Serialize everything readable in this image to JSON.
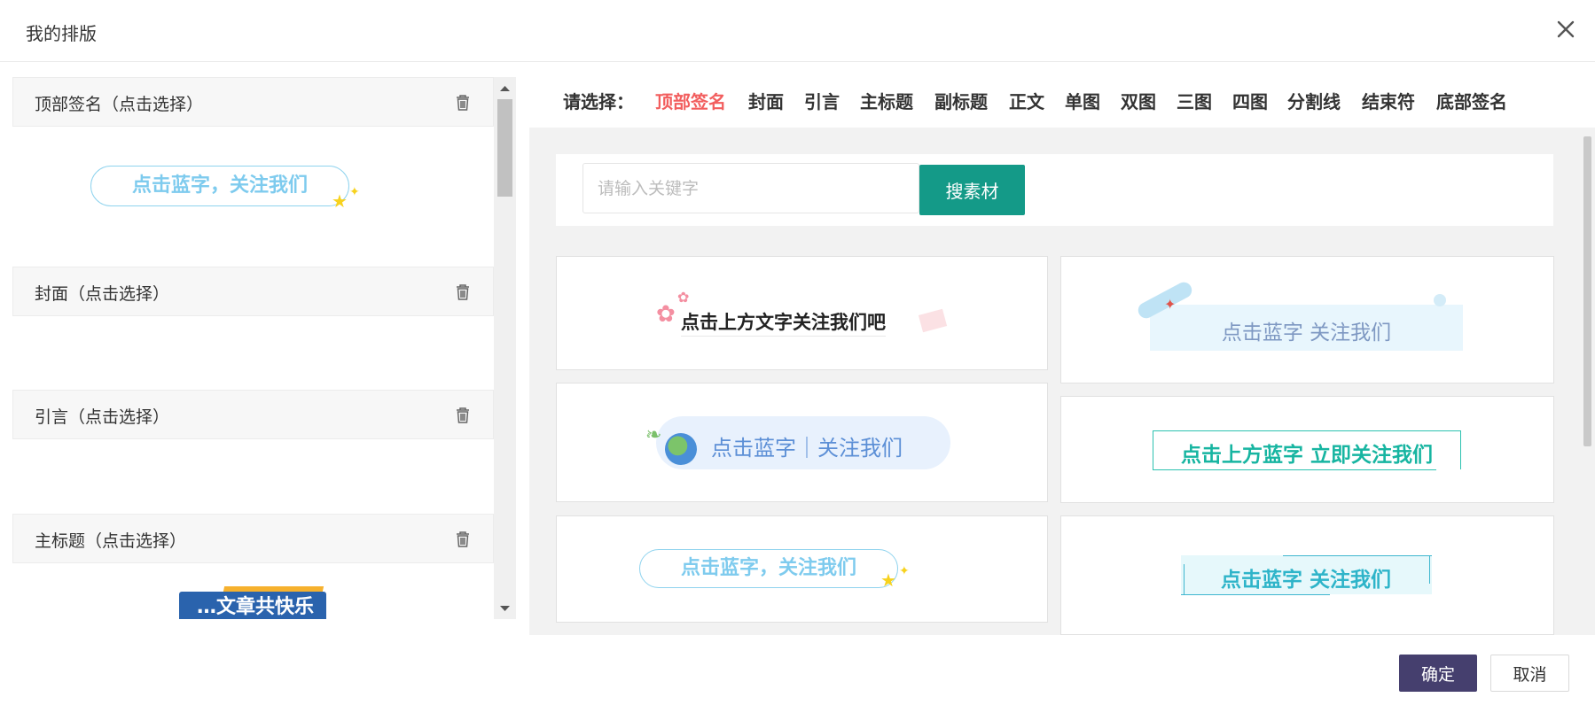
{
  "dialog": {
    "title": "我的排版",
    "close_icon": "close-icon"
  },
  "layout_sections": [
    {
      "label": "顶部签名（点击选择）",
      "icon": "trash-icon",
      "preview_text": "点击蓝字，关注我们"
    },
    {
      "label": "封面（点击选择）",
      "icon": "trash-icon"
    },
    {
      "label": "引言（点击选择）",
      "icon": "trash-icon"
    },
    {
      "label": "主标题（点击选择）",
      "icon": "trash-icon",
      "preview_text": "…文章共快乐"
    }
  ],
  "picker": {
    "prompt": "请选择：",
    "tabs": [
      "顶部签名",
      "封面",
      "引言",
      "主标题",
      "副标题",
      "正文",
      "单图",
      "双图",
      "三图",
      "四图",
      "分割线",
      "结束符",
      "底部签名"
    ],
    "active_tab": "顶部签名",
    "active_color": "#f25e5e"
  },
  "search": {
    "placeholder": "请输入关键字",
    "button_label": "搜素材",
    "button_color": "#149a88"
  },
  "templates": [
    {
      "text": "点击上方文字关注我们吧",
      "style": "flower"
    },
    {
      "text": "点击蓝字 关注我们",
      "style": "light-blue-banner"
    },
    {
      "text": "点击蓝字｜关注我们",
      "style": "earth-pill"
    },
    {
      "text": "点击上方蓝字 立即关注我们",
      "style": "teal-frame"
    },
    {
      "text": "点击蓝字，关注我们",
      "style": "star-pill"
    },
    {
      "text": "点击蓝字 关注我们",
      "style": "cyan-frame"
    }
  ],
  "footer": {
    "ok_label": "确定",
    "cancel_label": "取消",
    "ok_color": "#453f6e"
  }
}
